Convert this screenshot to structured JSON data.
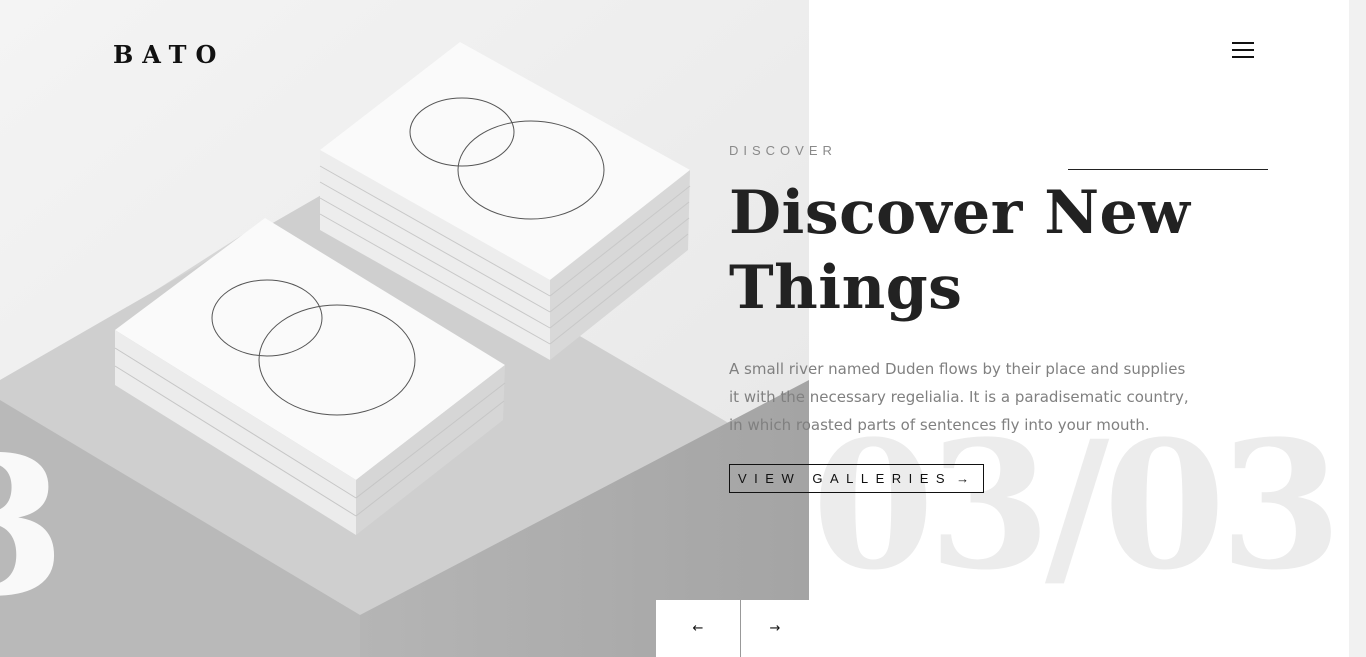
{
  "brand": {
    "logo": "BATO"
  },
  "header": {
    "menu_icon": "hamburger-menu-icon"
  },
  "hero": {
    "eyebrow": "DISCOVER",
    "title_line1": "Discover New",
    "title_line2": "Things",
    "description": "A small river named Duden flows by their place and supplies it with the necessary regelialia. It is a paradisematic country, in which roasted parts of sentences fly into your mouth.",
    "cta_label": "VIEW GALLERIES",
    "cta_icon": "arrow-right-icon",
    "slide_counter": "03/03",
    "slide_counter_left_fragment": "3"
  },
  "slider": {
    "prev_icon": "arrow-left-icon",
    "next_icon": "arrow-right-icon",
    "prev_glyph": "←",
    "next_glyph": "→",
    "cta_glyph": "→"
  },
  "colors": {
    "text_dark": "#222222",
    "text_muted": "#808080",
    "background": "#ffffff",
    "watermark": "#ececec"
  }
}
